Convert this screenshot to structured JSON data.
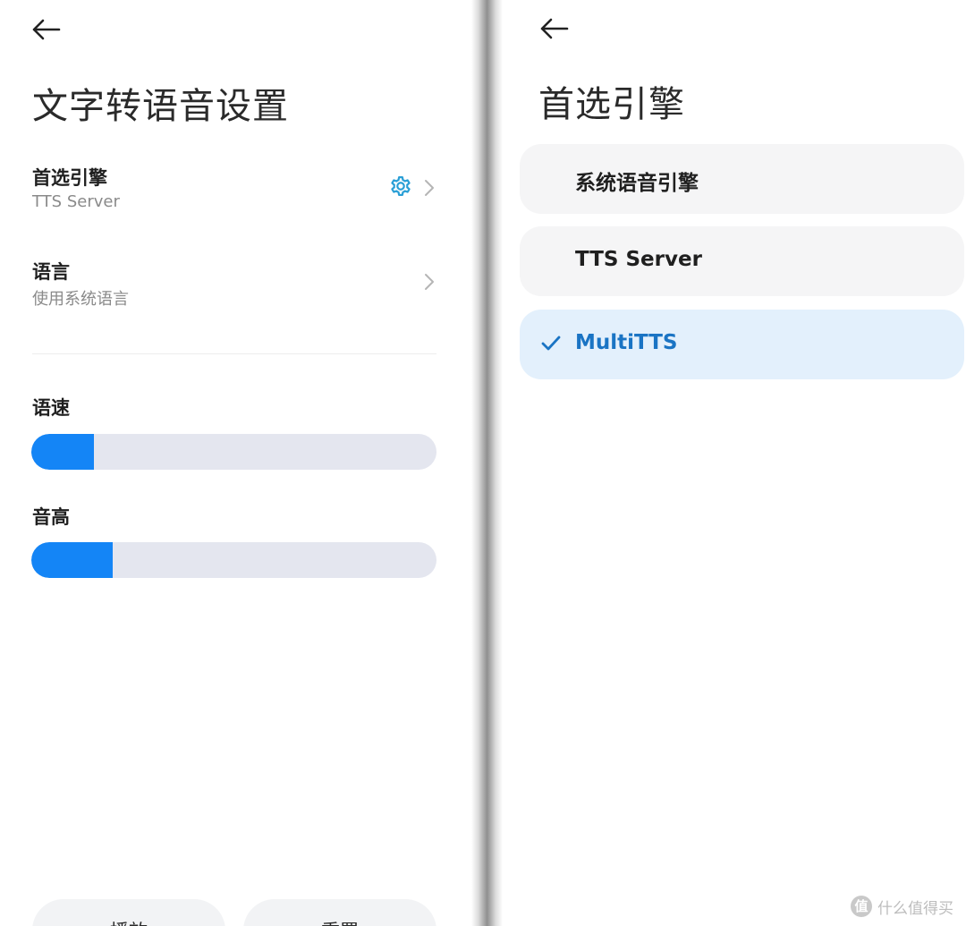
{
  "tts_settings": {
    "title": "文字转语音设置",
    "preferred_engine": {
      "label": "首选引擎",
      "value": "TTS Server"
    },
    "language": {
      "label": "语言",
      "value": "使用系统语言"
    },
    "speech_rate": {
      "label": "语速",
      "level_fraction": 0.155
    },
    "pitch": {
      "label": "音高",
      "level_fraction": 0.2
    },
    "bottom_buttons": {
      "play": "播放",
      "reset": "重置"
    }
  },
  "engine_picker": {
    "title": "首选引擎",
    "options": [
      {
        "label": "系统语音引擎",
        "selected": false
      },
      {
        "label": "TTS Server",
        "selected": false
      },
      {
        "label": "MultiTTS",
        "selected": true
      }
    ]
  },
  "watermark": {
    "text": "什么值得买",
    "badge": "值"
  },
  "colors": {
    "accent": "#1485f6",
    "selected_bg": "#e3f0fc",
    "selected_text": "#1a74c4",
    "gear_icon": "#2a9fd6",
    "track": "#e4e6ef"
  }
}
